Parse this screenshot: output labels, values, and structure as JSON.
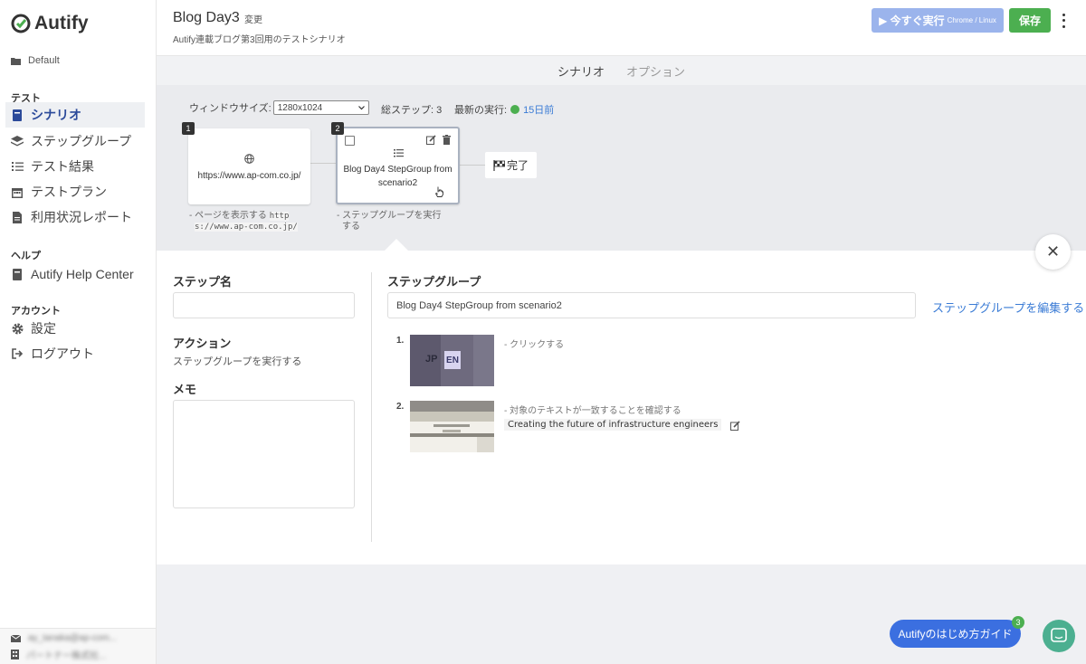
{
  "app": {
    "brand": "Autify",
    "workspace": "Default"
  },
  "sidebar": {
    "sections": [
      "テスト",
      "ヘルプ",
      "アカウント"
    ],
    "items": [
      {
        "label": "シナリオ",
        "icon": "book-icon",
        "active": true
      },
      {
        "label": "ステップグループ",
        "icon": "layers-icon"
      },
      {
        "label": "テスト結果",
        "icon": "list-check-icon"
      },
      {
        "label": "テストプラン",
        "icon": "calendar-icon"
      },
      {
        "label": "利用状況レポート",
        "icon": "report-icon"
      },
      {
        "label": "Autify Help Center",
        "icon": "book-icon"
      },
      {
        "label": "設定",
        "icon": "gear-icon"
      },
      {
        "label": "ログアウト",
        "icon": "logout-icon"
      }
    ],
    "footer": {
      "email": "ay_tanaka@ap-com...",
      "company": "パートナー株式社..."
    }
  },
  "header": {
    "title": "Blog Day3",
    "change_label": "変更",
    "description": "Autify連載ブログ第3回用のテストシナリオ",
    "run_label": "▶ 今すぐ実行",
    "run_sub": "Chrome / Linux",
    "save_label": "保存"
  },
  "tabs": [
    "シナリオ",
    "オプション"
  ],
  "canvas": {
    "window_size_label": "ウィンドウサイズ:",
    "window_size_value": "1280x1024",
    "total_steps": "総ステップ: 3",
    "last_run_label": "最新の実行:",
    "last_run_value": "15日前",
    "steps": [
      {
        "number": "1",
        "text": "https://www.ap-com.co.jp/",
        "caption": "- ページを表示する",
        "code1": "http",
        "code2": "s://www.ap-com.co.jp/"
      },
      {
        "number": "2",
        "text1": "Blog Day4 StepGroup from",
        "text2": "scenario2",
        "caption1": "- ステップグループを実行",
        "caption2": "する"
      }
    ],
    "done_label": "完了"
  },
  "panel": {
    "step_name_label": "ステップ名",
    "step_name_value": "",
    "action_label": "アクション",
    "action_value": "ステップグループを実行する",
    "memo_label": "メモ",
    "memo_value": "",
    "step_group_label": "ステップグループ",
    "step_group_value": "Blog Day4 StepGroup from scenario2",
    "edit_link": "ステップグループを編集する",
    "steps": [
      {
        "number": "1.",
        "text": "- クリックする",
        "thumb_jp": "JP",
        "thumb_en": "EN"
      },
      {
        "number": "2.",
        "text": "- 対象のテキストが一致することを確認する",
        "value": "Creating the future of infrastructure engineers"
      }
    ]
  },
  "widgets": {
    "guide_label": "Autifyのはじめ方ガイド",
    "guide_count": "3"
  },
  "colors": {
    "primary": "#3b6fe0",
    "success": "#4caf50",
    "run_disabled": "#9bb4ec",
    "link": "#3a7bd5"
  }
}
